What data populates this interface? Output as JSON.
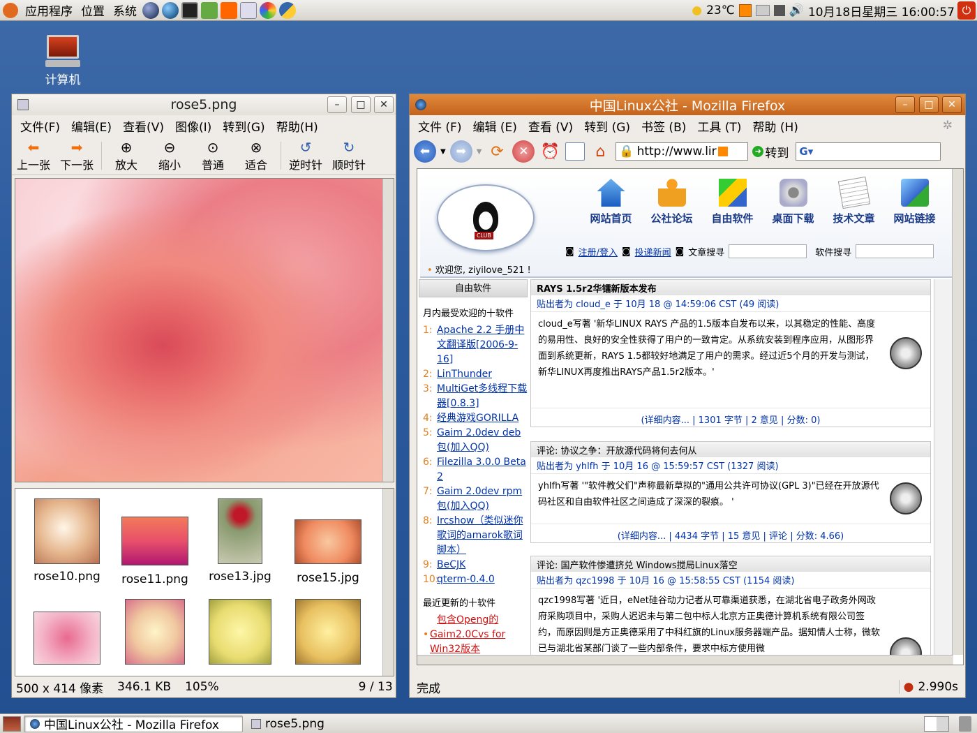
{
  "top_panel": {
    "menus": [
      "应用程序",
      "位置",
      "系统"
    ],
    "weather": "23℃",
    "datetime": "10月18日星期三 16:00:57"
  },
  "desktop": {
    "computer_label": "计算机"
  },
  "eog": {
    "title": "rose5.png",
    "menus": [
      "文件(F)",
      "编辑(E)",
      "查看(V)",
      "图像(I)",
      "转到(G)",
      "帮助(H)"
    ],
    "tools": [
      "上一张",
      "下一张",
      "放大",
      "缩小",
      "普通",
      "适合",
      "逆时针",
      "顺时针"
    ],
    "thumbnails": [
      "rose10.png",
      "rose11.png",
      "rose13.jpg",
      "rose15.jpg"
    ],
    "status": {
      "size": "500 x 414 像素",
      "filesize": "346.1 KB",
      "zoom": "105%",
      "position": "9 / 13"
    }
  },
  "firefox": {
    "title": "中国Linux公社 - Mozilla Firefox",
    "menus": [
      "文件 (F)",
      "编辑 (E)",
      "查看 (V)",
      "转到 (G)",
      "书签 (B)",
      "工具 (T)",
      "帮助 (H)"
    ],
    "url": "http://www.lir",
    "go_label": "转到",
    "status": "完成",
    "load_time": "2.990s"
  },
  "site": {
    "nav": [
      "网站首页",
      "公社论坛",
      "自由软件",
      "桌面下载",
      "技术文章",
      "网站链接"
    ],
    "search_links": [
      "注册/登入",
      "投递新闻",
      "文章搜寻"
    ],
    "software_search": "软件搜寻",
    "welcome": "欢迎您, ziyilove_521 !",
    "sidebar": {
      "header": "自由软件",
      "top10_title": "月内最受欢迎的十软件",
      "top10": [
        "Apache 2.2 手册中文翻译版[2006-9-16]",
        "LinThunder",
        "MultiGet多线程下载器[0.8.3]",
        "经典游戏GORILLA",
        "Gaim 2.0dev deb包(加入QQ)",
        "Filezilla 3.0.0 Beta 2",
        "Gaim 2.0dev rpm包(加入QQ)",
        "Ircshow（类似迷你歌词的amarok歌词脚本）",
        "BeCJK",
        "qterm-0.4.0"
      ],
      "recent_title": "最近更新的十软件",
      "recent": [
        "包含Openg的",
        "Gaim2.0Cvs for Win32版本"
      ]
    },
    "articles": [
      {
        "title": "RAYS 1.5r2华镭新版本发布",
        "meta": "贴出者为 cloud_e 于 10月 18 @ 14:59:06 CST (49 阅读)",
        "body": "cloud_e写著 '新华LINUX RAYS 产品的1.5版本自发布以来，以其稳定的性能、高度的易用性、良好的安全性获得了用户的一致肯定。从系统安装到程序应用，从图形界面到系统更新，RAYS 1.5都较好地满足了用户的需求。经过近5个月的开发与测试，新华LINUX再度推出RAYS产品1.5r2版本。'",
        "foot": "(详细内容... | 1301 字节 | 2 意见 | 分数:  0)"
      },
      {
        "title": "评论: 协议之争：开放源代码将何去何从",
        "meta": "贴出者为 yhlfh 于 10月 16 @ 15:59:57 CST (1327 阅读)",
        "body": "yhlfh写著 '\"软件教父们\"声称最新草拟的\"通用公共许可协议(GPL 3)\"已经在开放源代码社区和自由软件社区之间造成了深深的裂痕。 '",
        "foot": "(详细内容... | 4434 字节 | 15 意见 | 评论 | 分数:  4.66)"
      },
      {
        "title": "评论: 国产软件惨遭挤兑 Windows搅局Linux落空",
        "meta": "贴出者为 qzc1998 于 10月 16 @ 15:58:55 CST (1154 阅读)",
        "body": "qzc1998写著 '近日，eNet硅谷动力记者从可靠渠道获悉，在湖北省电子政务外网政府采购项目中，采购人迟迟未与第二包中标人北京方正奥德计算机系统有限公司签约，而原因则是方正奥德采用了中科红旗的Linux服务器端产品。据知情人士称，微软已与湖北省某部门谈了一些内部条件，要求中标方使用微",
        "foot": ""
      }
    ]
  },
  "taskbar": {
    "tasks": [
      "中国Linux公社 - Mozilla Firefox",
      "rose5.png"
    ]
  }
}
